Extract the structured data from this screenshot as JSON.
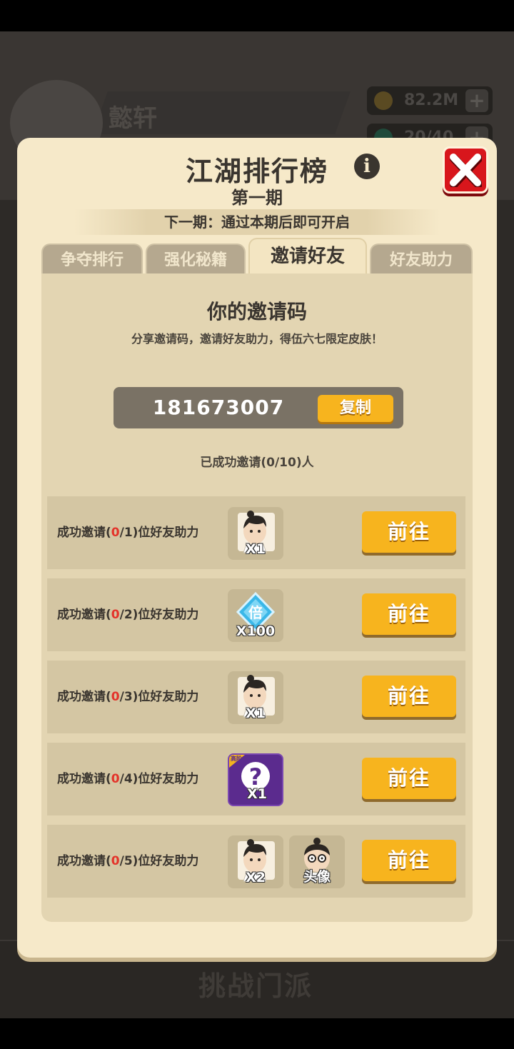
{
  "background": {
    "player_name": "懿轩",
    "resources": [
      {
        "icon": "coin-icon",
        "value": "82.2M"
      },
      {
        "icon": "energy-icon",
        "value": "20/40"
      }
    ],
    "bottom_title": "挑战门派"
  },
  "modal": {
    "title": "江湖排行榜",
    "subtitle": "第一期",
    "next_period": "下一期：通过本期后即可开启",
    "tabs": [
      {
        "label": "争夺排行",
        "active": false
      },
      {
        "label": "强化秘籍",
        "active": false
      },
      {
        "label": "邀请好友",
        "active": true
      },
      {
        "label": "好友助力",
        "active": false
      }
    ],
    "invite": {
      "heading": "你的邀请码",
      "description": "分享邀请码，邀请好友助力，得伍六七限定皮肤！",
      "code": "181673007",
      "copy_label": "复制",
      "invited_count": "已成功邀请(0/10)人"
    },
    "rows": [
      {
        "prefix": "成功邀请(",
        "current": "0",
        "suffix": "/1)位好友助力",
        "rewards": [
          {
            "type": "hero-portrait",
            "icon": "hero-portrait-icon",
            "qty": "X1"
          }
        ],
        "button": "前往"
      },
      {
        "prefix": "成功邀请(",
        "current": "0",
        "suffix": "/2)位好友助力",
        "rewards": [
          {
            "type": "multiplier-gem",
            "icon": "multiplier-gem-icon",
            "glyph": "倍",
            "qty": "X100"
          }
        ],
        "button": "前往"
      },
      {
        "prefix": "成功邀请(",
        "current": "0",
        "suffix": "/3)位好友助力",
        "rewards": [
          {
            "type": "hero-portrait",
            "icon": "hero-portrait-icon",
            "qty": "X1"
          }
        ],
        "button": "前往"
      },
      {
        "prefix": "成功邀请(",
        "current": "0",
        "suffix": "/4)位好友助力",
        "rewards": [
          {
            "type": "mystery-box",
            "icon": "question-mark-icon",
            "tier": "高阶",
            "qty": "X1"
          }
        ],
        "button": "前往"
      },
      {
        "prefix": "成功邀请(",
        "current": "0",
        "suffix": "/5)位好友助力",
        "rewards": [
          {
            "type": "hero-portrait",
            "icon": "hero-portrait-icon",
            "qty": "X2"
          },
          {
            "type": "avatar-frame",
            "icon": "avatar-icon",
            "qty": "头像"
          }
        ],
        "button": "前往"
      }
    ]
  },
  "colors": {
    "modal_bg": "#f6e9c9",
    "panel_bg": "#e3d5b2",
    "row_bg": "#d4c6a3",
    "button": "#f7b41e",
    "close": "#d8161c",
    "highlight_red": "#e3332a"
  }
}
